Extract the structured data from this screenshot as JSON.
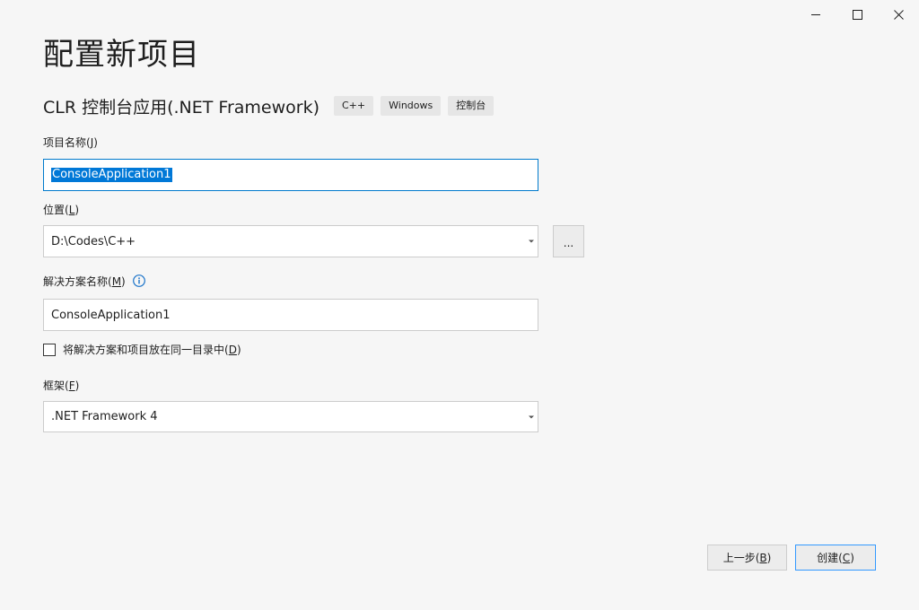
{
  "window": {
    "controls": {
      "minimize": "minimize-icon",
      "maximize": "maximize-icon",
      "close": "close-icon"
    }
  },
  "page": {
    "title": "配置新项目",
    "template_name": "CLR 控制台应用(.NET Framework)",
    "tags": [
      "C++",
      "Windows",
      "控制台"
    ]
  },
  "form": {
    "project_name": {
      "label": "项目名称(",
      "accel": "J",
      "label_end": ")",
      "value": "ConsoleApplication1"
    },
    "location": {
      "label": "位置(",
      "accel": "L",
      "label_end": ")",
      "value": "D:\\Codes\\C++",
      "browse_label": "..."
    },
    "solution_name": {
      "label": "解决方案名称(",
      "accel": "M",
      "label_end": ")",
      "value": "ConsoleApplication1"
    },
    "same_dir": {
      "label": "将解决方案和项目放在同一目录中(",
      "accel": "D",
      "label_end": ")",
      "checked": false
    },
    "framework": {
      "label": "框架(",
      "accel": "F",
      "label_end": ")",
      "value": ".NET Framework 4"
    }
  },
  "footer": {
    "back": {
      "label": "上一步(",
      "accel": "B",
      "label_end": ")"
    },
    "create": {
      "label": "创建(",
      "accel": "C",
      "label_end": ")"
    }
  },
  "colors": {
    "accent": "#007acc",
    "selection": "#0078d7",
    "primary_border": "#3399ff",
    "info_icon": "#1a73c9"
  }
}
